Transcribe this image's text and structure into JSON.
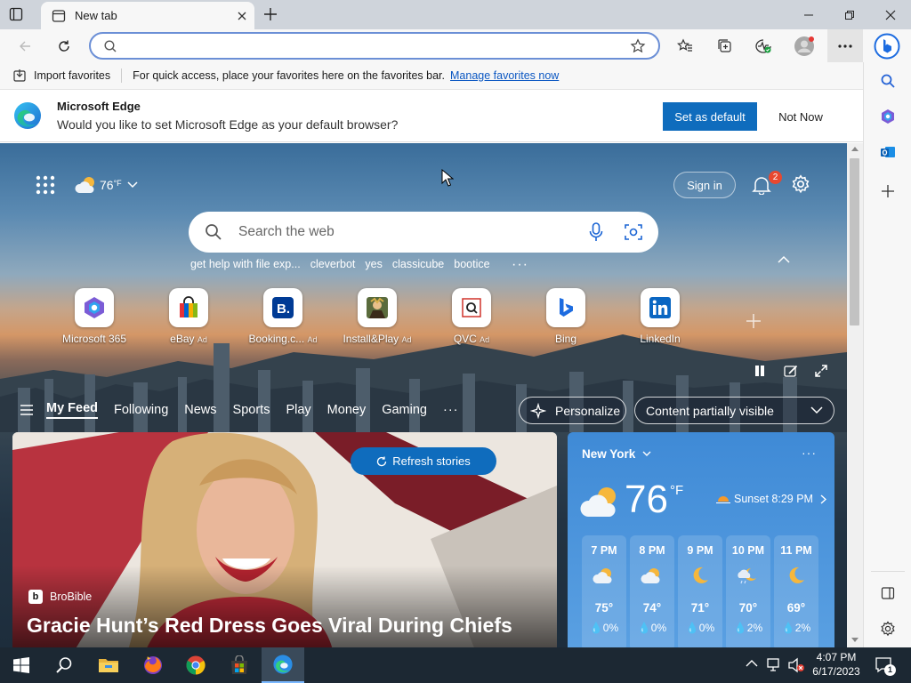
{
  "browser": {
    "tab_title": "New tab",
    "address_value": "",
    "favbar": {
      "import_label": "Import favorites",
      "message": "For quick access, place your favorites here on the favorites bar.",
      "manage_link": "Manage favorites now"
    },
    "banner": {
      "title": "Microsoft Edge",
      "message": "Would you like to set Microsoft Edge as your default browser?",
      "set_default": "Set as default",
      "not_now": "Not Now"
    }
  },
  "newtab": {
    "weather_temp": "76",
    "weather_unit": "°F",
    "sign_in": "Sign in",
    "notifications_count": "2",
    "search_placeholder": "Search the web",
    "suggestions": [
      "get help with file exp...",
      "cleverbot",
      "yes",
      "classicube",
      "bootice"
    ],
    "quick_links": [
      {
        "label": "Microsoft 365",
        "ad": ""
      },
      {
        "label": "eBay",
        "ad": "Ad"
      },
      {
        "label": "Booking.c...",
        "ad": "Ad"
      },
      {
        "label": "Install&Play",
        "ad": "Ad"
      },
      {
        "label": "QVC",
        "ad": "Ad"
      },
      {
        "label": "Bing",
        "ad": ""
      },
      {
        "label": "LinkedIn",
        "ad": ""
      }
    ],
    "feed_tabs": [
      "My Feed",
      "Following",
      "News",
      "Sports",
      "Play",
      "Money",
      "Gaming"
    ],
    "personalize": "Personalize",
    "content_visibility": "Content partially visible",
    "refresh": "Refresh stories",
    "hero": {
      "source": "BroBible",
      "headline": "Gracie Hunt’s Red Dress Goes Viral During Chiefs"
    },
    "weather_card": {
      "city": "New York",
      "temp": "76",
      "unit": "°F",
      "sunset": "Sunset 8:29 PM",
      "hours": [
        {
          "time": "7 PM",
          "icon": "partly-cloudy-icon",
          "temp": "75°",
          "precip": "0%"
        },
        {
          "time": "8 PM",
          "icon": "partly-cloudy-icon",
          "temp": "74°",
          "precip": "0%"
        },
        {
          "time": "9 PM",
          "icon": "moon-icon",
          "temp": "71°",
          "precip": "0%"
        },
        {
          "time": "10 PM",
          "icon": "cloudy-night-icon",
          "temp": "70°",
          "precip": "2%"
        },
        {
          "time": "11 PM",
          "icon": "moon-icon",
          "temp": "69°",
          "precip": "2%"
        }
      ]
    }
  },
  "taskbar": {
    "time": "4:07 PM",
    "date": "6/17/2023",
    "notification_count": "1"
  },
  "colors": {
    "accent": "#0f6cbd",
    "taskbar": "#1c2833",
    "weather": "#4a93dc"
  }
}
